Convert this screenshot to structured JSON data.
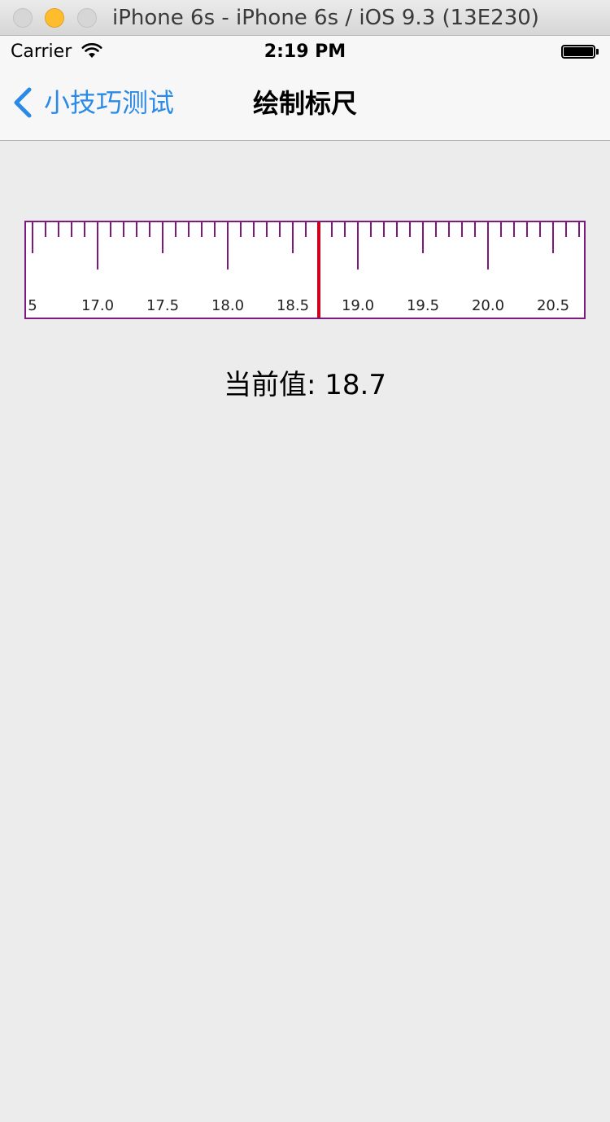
{
  "window": {
    "title": "iPhone 6s - iPhone 6s / iOS 9.3 (13E230)"
  },
  "status_bar": {
    "carrier": "Carrier",
    "time": "2:19 PM",
    "wifi_icon": "wifi-icon",
    "battery_icon": "battery-icon",
    "battery_level": 1.0
  },
  "nav": {
    "back_label": "小技巧测试",
    "back_icon": "chevron-left-icon",
    "title": "绘制标尺"
  },
  "ruler": {
    "range": [
      16.5,
      20.8
    ],
    "step": 0.1,
    "current": 18.7,
    "labels": [
      {
        "text": "5",
        "value": 16.5
      },
      {
        "text": "17.0",
        "value": 17.0
      },
      {
        "text": "17.5",
        "value": 17.5
      },
      {
        "text": "18.0",
        "value": 18.0
      },
      {
        "text": "18.5",
        "value": 18.5
      },
      {
        "text": "19.0",
        "value": 19.0
      },
      {
        "text": "19.5",
        "value": 19.5
      },
      {
        "text": "20.0",
        "value": 20.0
      },
      {
        "text": "20.5",
        "value": 20.5
      }
    ],
    "tick_color": "#7d1a7d",
    "indicator_color": "#d0021b"
  },
  "current_value": {
    "text": "当前值: 18.7"
  },
  "colors": {
    "accent": "#2a8ae6",
    "background": "#ececec"
  }
}
